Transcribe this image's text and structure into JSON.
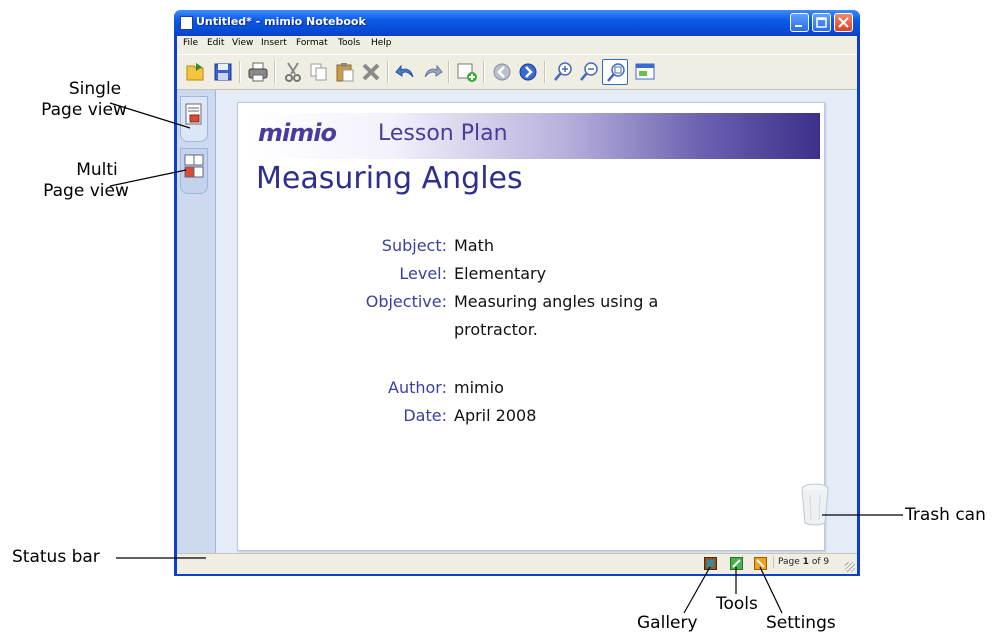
{
  "window": {
    "title": "Untitled* - mimio Notebook"
  },
  "menu": [
    "File",
    "Edit",
    "View",
    "Insert",
    "Format",
    "Tools",
    "Help"
  ],
  "toolbar_icons": [
    "open-icon",
    "save-icon",
    "print-icon",
    "cut-icon",
    "copy-icon",
    "paste-icon",
    "delete-icon",
    "undo-icon",
    "redo-icon",
    "new-page-icon",
    "previous-page-icon",
    "next-page-icon",
    "zoom-in-icon",
    "zoom-out-icon",
    "zoom-fit-icon",
    "full-screen-icon"
  ],
  "page": {
    "logo": "mimio",
    "banner": "Lesson Plan",
    "title": "Measuring Angles",
    "fields": [
      {
        "label": "Subject:",
        "value": "Math"
      },
      {
        "label": "Level:",
        "value": "Elementary"
      },
      {
        "label": "Objective:",
        "value": "Measuring angles using a",
        "value2": "protractor."
      },
      {
        "label": "Author:",
        "value": "mimio"
      },
      {
        "label": "Date:",
        "value": "April 2008"
      }
    ]
  },
  "status": {
    "page_prefix": "Page",
    "page_current": "1",
    "page_mid": "of",
    "page_total": "9"
  },
  "callouts": {
    "single_line1": "Single",
    "single_line2": "Page view",
    "multi_line1": "Multi",
    "multi_line2": "Page view",
    "status_bar": "Status bar",
    "trash_can": "Trash can",
    "gallery": "Gallery",
    "tools": "Tools",
    "settings": "Settings"
  },
  "colors": {
    "title_blue": "#0649d4",
    "page_text": "#2e2f8c",
    "label_text": "#3a3fa0",
    "banner_purple": "#3d3089"
  }
}
